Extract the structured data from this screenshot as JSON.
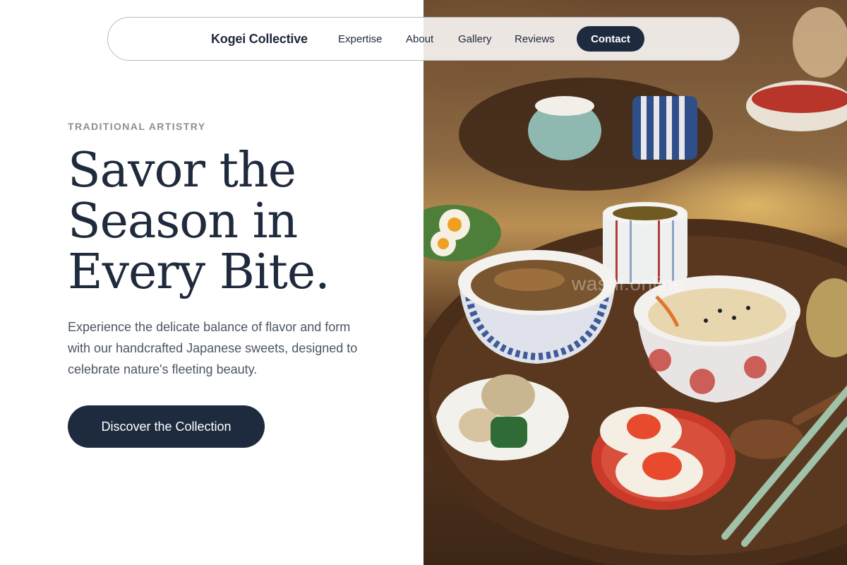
{
  "nav": {
    "brand": "Kogei Collective",
    "links": [
      "Expertise",
      "About",
      "Gallery",
      "Reviews"
    ],
    "contact_label": "Contact"
  },
  "hero": {
    "eyebrow": "TRADITIONAL ARTISTRY",
    "headline_lines": [
      "Savor the",
      "Season in",
      "Every Bite."
    ],
    "description": "Experience the delicate balance of flavor and form with our handcrafted Japanese sweets, designed to celebrate nature's fleeting beauty.",
    "cta_label": "Discover the Collection"
  },
  "photo": {
    "description_icon": "japanese-meal-photo",
    "watermark": "washi.online"
  },
  "colors": {
    "primary_dark": "#1e2b3f",
    "text": "#1f2a3c",
    "muted": "#8b8f97",
    "body": "#4c5564",
    "background": "#ffffff"
  }
}
